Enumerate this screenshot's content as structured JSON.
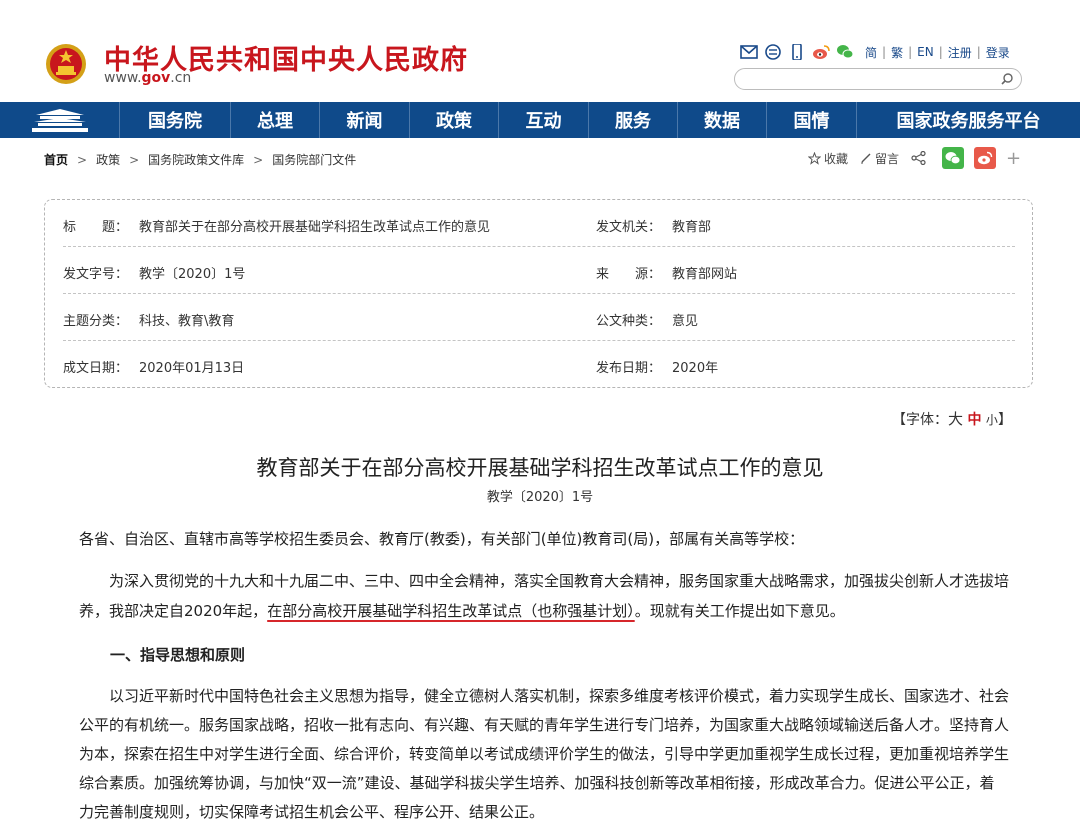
{
  "header": {
    "site_title": "中华人民共和国中央人民政府",
    "site_url_prefix": "www.",
    "site_url_gov": "gov",
    "site_url_suffix": ".cn",
    "tools": {
      "jian": "简",
      "fan": "繁",
      "en": "EN",
      "register": "注册",
      "login": "登录",
      "sep": "|"
    },
    "search": {
      "placeholder": ""
    }
  },
  "nav": {
    "items": [
      "国务院",
      "总理",
      "新闻",
      "政策",
      "互动",
      "服务",
      "数据",
      "国情",
      "国家政务服务平台"
    ]
  },
  "breadcrumb": {
    "items": [
      "首页",
      "政策",
      "国务院政策文件库",
      "国务院部门文件"
    ],
    "arrow": ">"
  },
  "share": {
    "favorite": "收藏",
    "comment": "留言",
    "plus": "+"
  },
  "info": {
    "rows": [
      {
        "l_label": "标　　题：",
        "l_value": "教育部关于在部分高校开展基础学科招生改革试点工作的意见",
        "r_label": "发文机关：",
        "r_value": "教育部"
      },
      {
        "l_label": "发文字号：",
        "l_value": "教学〔2020〕1号",
        "r_label": "来　　源：",
        "r_value": "教育部网站"
      },
      {
        "l_label": "主题分类：",
        "l_value": "科技、教育\\教育",
        "r_label": "公文种类：",
        "r_value": "意见"
      },
      {
        "l_label": "成文日期：",
        "l_value": "2020年01月13日",
        "r_label": "发布日期：",
        "r_value": "2020年"
      }
    ]
  },
  "font_control": {
    "open": "【字体：",
    "big": "大",
    "mid": "中",
    "small": "小",
    "close": "】"
  },
  "article": {
    "title": "教育部关于在部分高校开展基础学科招生改革试点工作的意见",
    "doc_no": "教学〔2020〕1号",
    "greeting": "各省、自治区、直辖市高等学校招生委员会、教育厅(教委)，有关部门(单位)教育司(局)，部属有关高等学校：",
    "intro_before": "为深入贯彻党的十九大和十九届二中、三中、四中全会精神，落实全国教育大会精神，服务国家重大战略需求，加强拔尖创新人才选拔培养，我部决定自2020年起，",
    "intro_highlight": "在部分高校开展基础学科招生改革试点（也称强基计划）",
    "intro_after": "。现就有关工作提出如下意见。",
    "section1_heading": "一、指导思想和原则",
    "section1_body": "以习近平新时代中国特色社会主义思想为指导，健全立德树人落实机制，探索多维度考核评价模式，着力实现学生成长、国家选才、社会公平的有机统一。服务国家战略，招收一批有志向、有兴趣、有天赋的青年学生进行专门培养，为国家重大战略领域输送后备人才。坚持育人为本，探索在招生中对学生进行全面、综合评价，转变简单以考试成绩评价学生的做法，引导中学更加重视学生成长过程，更加重视培养学生综合素质。加强统筹协调，与加快“双一流”建设、基础学科拔尖学生培养、加强科技创新等改革相衔接，形成改革合力。促进公平公正，着力完善制度规则，切实保障考试招生机会公平、程序公开、结果公正。"
  },
  "colors": {
    "brand_red": "#c8161d",
    "nav_blue": "#0f4a8a",
    "highlight_red": "#d6262b"
  }
}
